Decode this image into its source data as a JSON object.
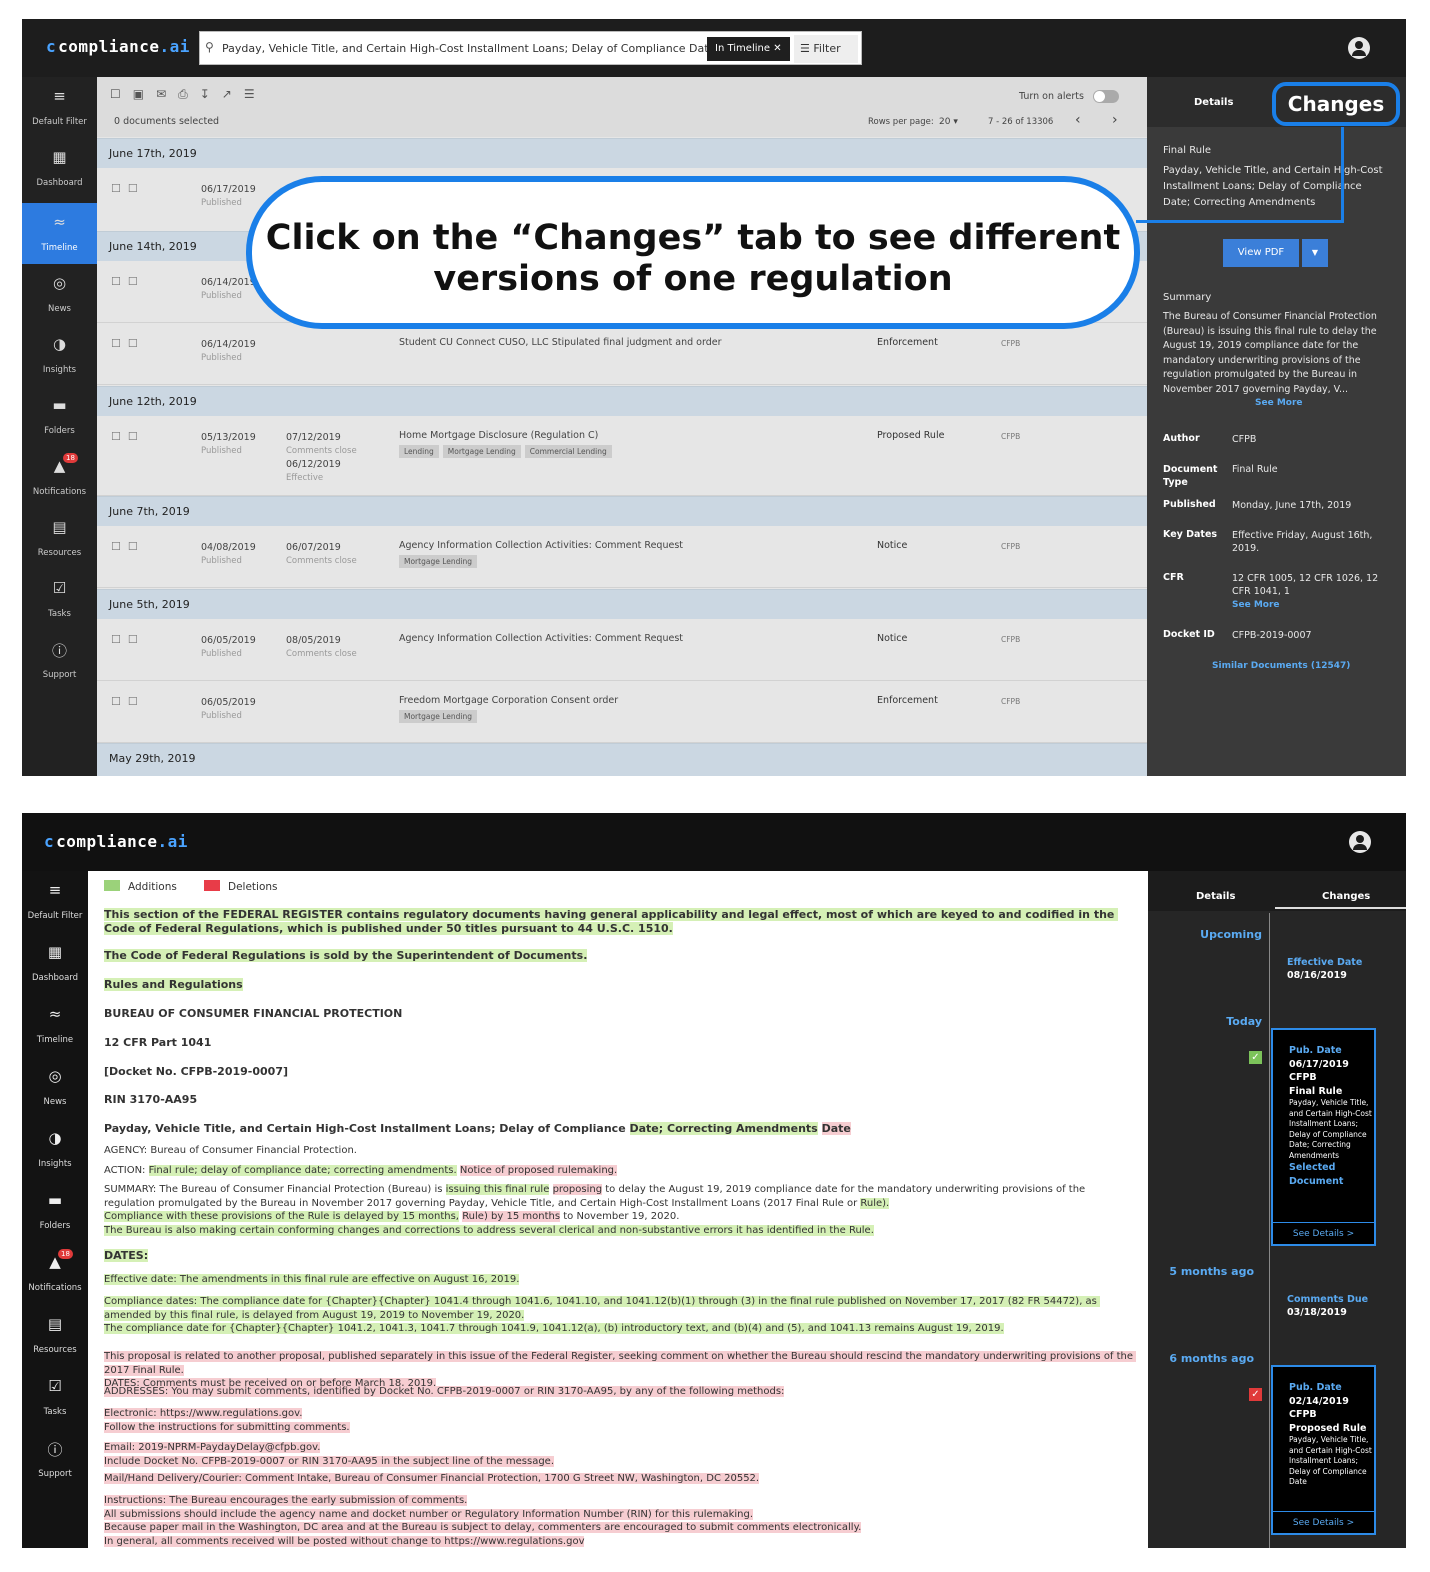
{
  "colors": {
    "accent": "#1a7fe8",
    "additions": "#d5f0b6",
    "deletions": "#f6cdd1",
    "link": "#5aaaf2",
    "badge": "#e03a3a"
  },
  "logo": {
    "mark": "c",
    "brand": "compliance",
    ".ai": ".ai"
  },
  "nav": [
    {
      "label": "Default Filter",
      "icon": "filter-icon"
    },
    {
      "label": "Dashboard",
      "icon": "dashboard-icon"
    },
    {
      "label": "Timeline",
      "icon": "timeline-icon"
    },
    {
      "label": "News",
      "icon": "globe-icon"
    },
    {
      "label": "Insights",
      "icon": "pie-chart-icon"
    },
    {
      "label": "Folders",
      "icon": "folder-icon"
    },
    {
      "label": "Notifications",
      "icon": "bell-icon",
      "badge": "18"
    },
    {
      "label": "Resources",
      "icon": "resources-icon"
    },
    {
      "label": "Tasks",
      "icon": "checkbox-icon"
    },
    {
      "label": "Support",
      "icon": "info-icon"
    }
  ],
  "s1": {
    "search": {
      "query": "Payday, Vehicle Title, and Certain High-Cost Installment Loans; Delay of Compliance Date; C...",
      "chip": "In Timeline",
      "filter": "Filter"
    },
    "toolbar": {
      "selected": "0 documents selected",
      "alerts": "Turn on alerts",
      "rows_per_page": "Rows per page:",
      "rows_value": "20",
      "range": "7 - 26 of 13306"
    },
    "dates": [
      "June 17th, 2019",
      "June 14th, 2019",
      "June 12th, 2019",
      "June 7th, 2019",
      "June 5th, 2019",
      "May 29th, 2019"
    ],
    "rows": [
      {
        "pub": "06/17/2019",
        "pub_s": "Published",
        "d2": "",
        "d2_s": "",
        "d3": "",
        "d3_s": "",
        "title": "",
        "tags": [],
        "type": "",
        "agency": ""
      },
      {
        "pub": "06/14/2019",
        "pub_s": "Published",
        "d2": "",
        "d2_s": "",
        "d3": "",
        "d3_s": "",
        "title": "",
        "tags": [],
        "type": "",
        "agency": ""
      },
      {
        "pub": "06/14/2019",
        "pub_s": "Published",
        "d2": "",
        "d2_s": "",
        "d3": "",
        "d3_s": "",
        "title": "Student CU Connect CUSO, LLC Stipulated final judgment and order",
        "tags": [],
        "type": "Enforcement",
        "agency": "CFPB"
      },
      {
        "pub": "05/13/2019",
        "pub_s": "Published",
        "d2": "07/12/2019",
        "d2_s": "Comments close",
        "d3": "06/12/2019",
        "d3_s": "Effective",
        "title": "Home Mortgage Disclosure (Regulation C)",
        "tags": [
          "Lending",
          "Mortgage Lending",
          "Commercial Lending"
        ],
        "type": "Proposed Rule",
        "agency": "CFPB"
      },
      {
        "pub": "04/08/2019",
        "pub_s": "Published",
        "d2": "06/07/2019",
        "d2_s": "Comments close",
        "d3": "",
        "d3_s": "",
        "title": "Agency Information Collection Activities: Comment Request",
        "tags": [
          "Mortgage Lending"
        ],
        "type": "Notice",
        "agency": "CFPB"
      },
      {
        "pub": "06/05/2019",
        "pub_s": "Published",
        "d2": "08/05/2019",
        "d2_s": "Comments close",
        "d3": "",
        "d3_s": "",
        "title": "Agency Information Collection Activities: Comment Request",
        "tags": [],
        "type": "Notice",
        "agency": "CFPB"
      },
      {
        "pub": "06/05/2019",
        "pub_s": "Published",
        "d2": "",
        "d2_s": "",
        "d3": "",
        "d3_s": "",
        "title": "Freedom Mortgage Corporation Consent order",
        "tags": [
          "Mortgage Lending"
        ],
        "type": "Enforcement",
        "agency": "CFPB"
      }
    ],
    "panel": {
      "tab_details": "Details",
      "tab_changes": "Changes",
      "doc_type": "Final Rule",
      "doc_title": "Payday, Vehicle Title, and Certain High-Cost Installment Loans; Delay of Compliance Date; Correcting Amendments",
      "view_pdf": "View PDF",
      "summary_label": "Summary",
      "summary": "The Bureau of Consumer Financial Protection (Bureau) is issuing this final rule to delay the August 19, 2019 compliance date for the mandatory underwriting provisions of the regulation promulgated by the Bureau in November 2017 governing Payday, V...",
      "see_more": "See More",
      "fields": [
        {
          "label": "Author",
          "value": "CFPB"
        },
        {
          "label": "Document Type",
          "value": "Final Rule"
        },
        {
          "label": "Published",
          "value": "Monday, June 17th, 2019"
        },
        {
          "label": "Key Dates",
          "value": "Effective Friday, August 16th, 2019."
        },
        {
          "label": "CFR",
          "value": "12 CFR 1005, 12 CFR 1026, 12 CFR 1041, 1"
        },
        {
          "label": "Docket ID",
          "value": "CFPB-2019-0007"
        }
      ],
      "cfr_more": "See More",
      "similar": "Similar Documents (12547)"
    },
    "callout": "Click on the “Changes” tab to see different versions of one regulation"
  },
  "s2": {
    "legend": {
      "add": "Additions",
      "del": "Deletions"
    },
    "paragraphs": [
      {
        "b": true,
        "segs": [
          {
            "t": "This section of the FEDERAL REGISTER contains regulatory documents having general applicability and legal effect, most of which are keyed to and codified in the Code of Federal Regulations, which is published under 50 titles pursuant to 44 U.S.C. 1510.",
            "c": "a"
          }
        ]
      },
      {
        "b": true,
        "segs": [
          {
            "t": "The Code of Federal Regulations is sold by the Superintendent of Documents.",
            "c": "a"
          }
        ]
      },
      {
        "b": true,
        "segs": [
          {
            "t": "Rules and Regulations",
            "c": "a"
          }
        ]
      },
      {
        "b": true,
        "segs": [
          {
            "t": "BUREAU OF CONSUMER FINANCIAL PROTECTION",
            "c": ""
          }
        ]
      },
      {
        "b": true,
        "segs": [
          {
            "t": "12 CFR Part 1041",
            "c": ""
          }
        ]
      },
      {
        "b": true,
        "segs": [
          {
            "t": "[Docket No. CFPB-2019-0007]",
            "c": ""
          }
        ]
      },
      {
        "b": true,
        "segs": [
          {
            "t": "RIN 3170-AA95",
            "c": ""
          }
        ]
      },
      {
        "b": true,
        "segs": [
          {
            "t": "Payday, Vehicle Title, and Certain High-Cost Installment Loans; Delay of Compliance ",
            "c": ""
          },
          {
            "t": "Date; Correcting Amendments",
            "c": "a"
          },
          {
            "t": " ",
            "c": ""
          },
          {
            "t": "Date",
            "c": "d"
          }
        ]
      },
      {
        "b": false,
        "segs": [
          {
            "t": "AGENCY: Bureau of Consumer Financial Protection.",
            "c": ""
          }
        ]
      },
      {
        "b": false,
        "segs": [
          {
            "t": "ACTION: ",
            "c": ""
          },
          {
            "t": "Final rule; delay of compliance date; correcting amendments.",
            "c": "a"
          },
          {
            "t": " ",
            "c": ""
          },
          {
            "t": "Notice of proposed rulemaking.",
            "c": "d"
          }
        ]
      },
      {
        "b": false,
        "segs": [
          {
            "t": "SUMMARY: The Bureau of Consumer Financial Protection (Bureau) is ",
            "c": ""
          },
          {
            "t": "issuing this final rule",
            "c": "a"
          },
          {
            "t": " ",
            "c": ""
          },
          {
            "t": "proposing",
            "c": "d"
          },
          {
            "t": " to delay the August 19, 2019 compliance date for the mandatory underwriting provisions of the regulation promulgated by the Bureau in November 2017 governing Payday, Vehicle Title, and Certain High-Cost Installment Loans (2017 Final Rule or ",
            "c": ""
          },
          {
            "t": "Rule).",
            "c": "a"
          },
          {
            "t": "\n",
            "c": ""
          },
          {
            "t": "Compliance with these provisions of the Rule is delayed by 15 months,",
            "c": "a"
          },
          {
            "t": " ",
            "c": ""
          },
          {
            "t": "Rule) by 15 months",
            "c": "d"
          },
          {
            "t": " to November 19, 2020.\n",
            "c": ""
          },
          {
            "t": "The Bureau is also making certain conforming changes and corrections to address several clerical and non-substantive errors it has identified in the Rule.",
            "c": "a"
          }
        ]
      },
      {
        "b": true,
        "segs": [
          {
            "t": "DATES:",
            "c": "a"
          }
        ]
      },
      {
        "b": false,
        "segs": [
          {
            "t": "Effective date: The amendments in this final rule are effective on August 16, 2019.",
            "c": "a"
          }
        ]
      },
      {
        "b": false,
        "segs": [
          {
            "t": "Compliance dates: The compliance date for {Chapter}{Chapter} 1041.4 through 1041.6, 1041.10, and 1041.12(b)(1) through (3) in the final rule published on November 17, 2017 (82 FR 54472), as amended by this final rule, is delayed from August 19, 2019 to November 19, 2020.\nThe compliance date for {Chapter}{Chapter} 1041.2, 1041.3, 1041.7 through 1041.9, 1041.12(a), (b) introductory text, and (b)(4) and (5), and 1041.13 remains August 19, 2019.",
            "c": "a"
          }
        ]
      },
      {
        "b": false,
        "segs": [
          {
            "t": "This proposal is related to another proposal, published separately in this issue of the Federal Register, seeking comment on whether the Bureau should rescind the mandatory underwriting provisions of the 2017 Final Rule.\nDATES: Comments must be received on or before March 18, 2019.",
            "c": "d"
          }
        ]
      },
      {
        "b": false,
        "segs": [
          {
            "t": "ADDRESSES: You may submit comments, identified by Docket No. CFPB-2019-0007 or RIN 3170-AA95, by any of the following methods:",
            "c": "d"
          }
        ]
      },
      {
        "b": false,
        "segs": [
          {
            "t": "Electronic: https://www.regulations.gov.\nFollow the instructions for submitting comments.",
            "c": "d"
          }
        ]
      },
      {
        "b": false,
        "segs": [
          {
            "t": "Email: 2019-NPRM-PaydayDelay@cfpb.gov.\nInclude Docket No. CFPB-2019-0007 or RIN 3170-AA95 in the subject line of the message.",
            "c": "d"
          }
        ]
      },
      {
        "b": false,
        "segs": [
          {
            "t": "Mail/Hand Delivery/Courier: Comment Intake, Bureau of Consumer Financial Protection, 1700 G Street NW, Washington, DC 20552.",
            "c": "d"
          }
        ]
      },
      {
        "b": false,
        "segs": [
          {
            "t": "Instructions: The Bureau encourages the early submission of comments.\nAll submissions should include the agency name and docket number or Regulatory Information Number (RIN) for this rulemaking.\nBecause paper mail in the Washington, DC area and at the Bureau is subject to delay, commenters are encouraged to submit comments electronically.\nIn general, all comments received will be posted without change to https://www.regulations.gov",
            "c": "d"
          }
        ]
      }
    ],
    "panel": {
      "tab_details": "Details",
      "tab_changes": "Changes",
      "upcoming": "Upcoming",
      "eff_label": "Effective Date",
      "eff_value": "08/16/2019",
      "today": "Today",
      "card1": {
        "h": "Pub. Date",
        "date": "06/17/2019",
        "agency": "CFPB",
        "type": "Final Rule",
        "title": "Payday, Vehicle Title, and Certain High-Cost Installment Loans; Delay of Compliance Date; Correcting Amendments",
        "selected": "Selected Document",
        "details": "See Details >"
      },
      "ago1": "5 months ago",
      "cd_label": "Comments Due",
      "cd_value": "03/18/2019",
      "ago2": "6 months ago",
      "card2": {
        "h": "Pub. Date",
        "date": "02/14/2019",
        "agency": "CFPB",
        "type": "Proposed Rule",
        "title": "Payday, Vehicle Title, and Certain High-Cost Installment Loans; Delay of Compliance Date",
        "details": "See Details >"
      }
    }
  }
}
